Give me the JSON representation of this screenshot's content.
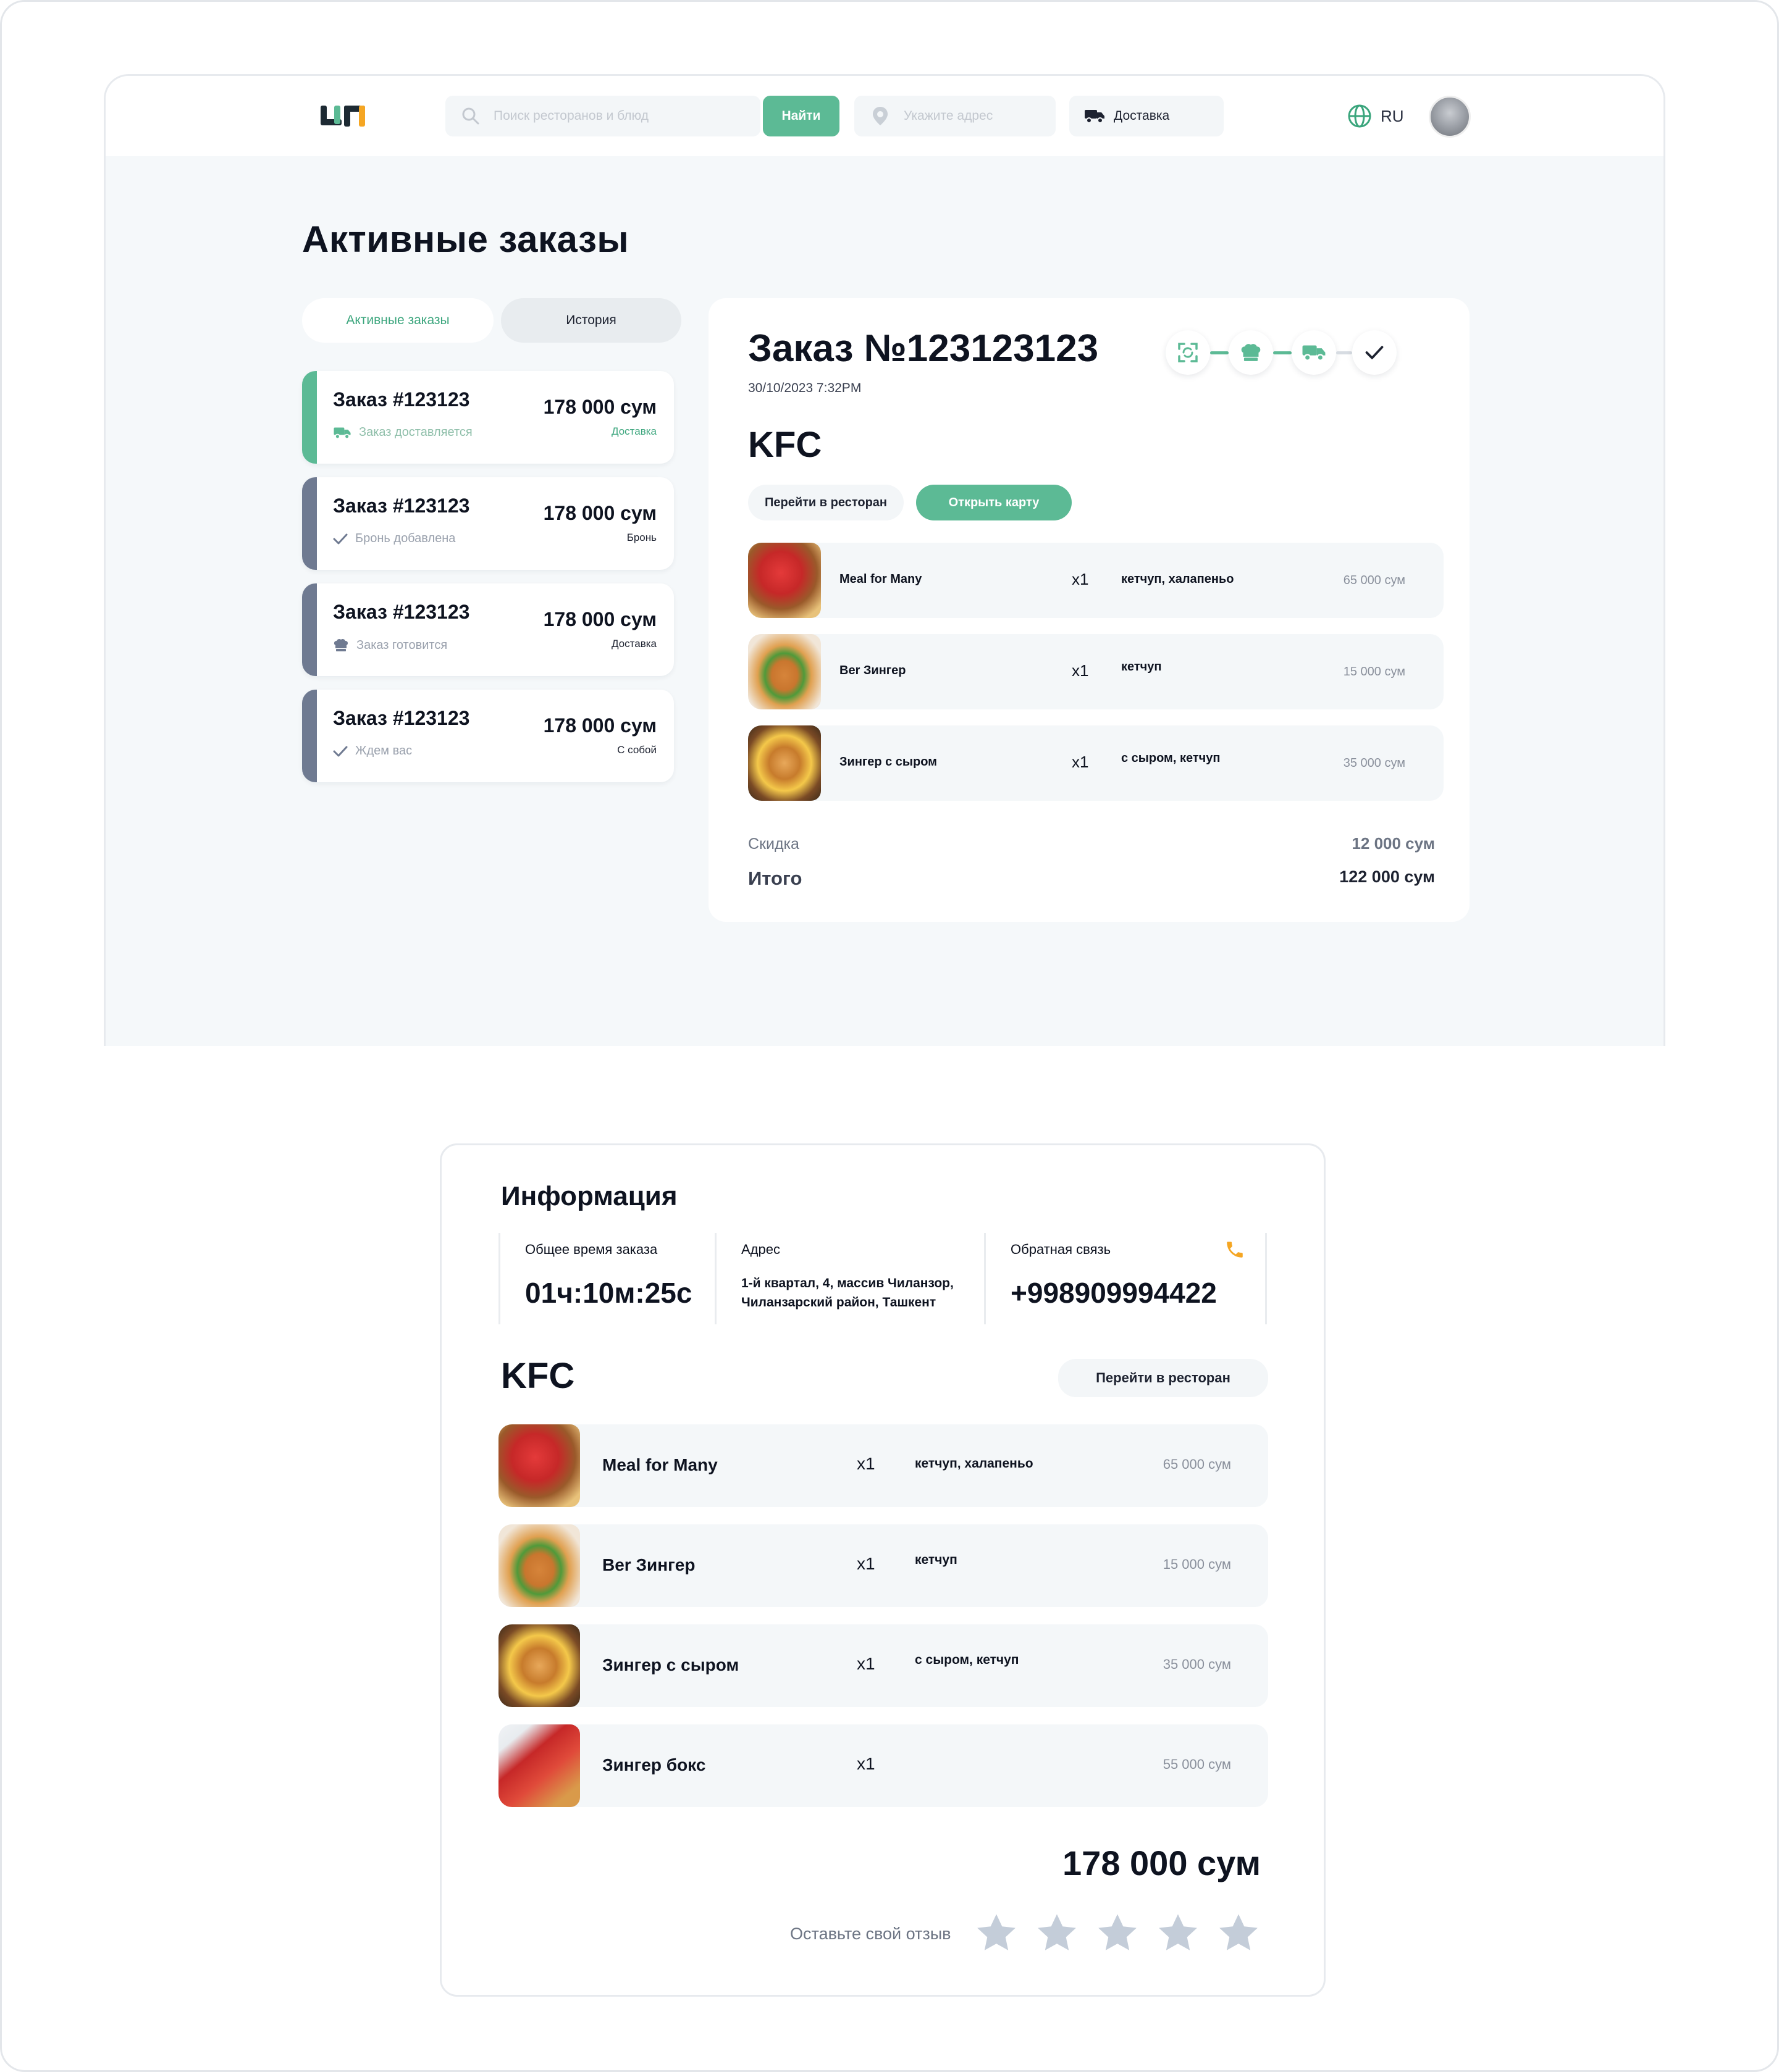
{
  "header": {
    "search_placeholder": "Поиск ресторанов и блюд",
    "find_label": "Найти",
    "address_placeholder": "Укажите адрес",
    "delivery_label": "Доставка",
    "language": "RU"
  },
  "page": {
    "title": "Активные заказы",
    "tabs": {
      "active": "Активные заказы",
      "history": "История"
    }
  },
  "orders": [
    {
      "title": "Заказ #123123",
      "status": "Заказ доставляется",
      "price": "178 000 сум",
      "type": "Доставка",
      "status_icon": "truck-icon",
      "accent": "#5cba95"
    },
    {
      "title": "Заказ #123123",
      "status": "Бронь добавлена",
      "price": "178 000 сум",
      "type": "Бронь",
      "status_icon": "check-icon",
      "accent": "#6f7a91"
    },
    {
      "title": "Заказ #123123",
      "status": "Заказ готовится",
      "price": "178 000 сум",
      "type": "Доставка",
      "status_icon": "chef-hat-icon",
      "accent": "#6f7a91"
    },
    {
      "title": "Заказ #123123",
      "status": "Ждем вас",
      "price": "178 000 сум",
      "type": "С собой",
      "status_icon": "check-icon",
      "accent": "#6f7a91"
    }
  ],
  "detail": {
    "title": "Заказ №123123123",
    "datetime": "30/10/2023  7:32PM",
    "restaurant": "KFC",
    "go_to_restaurant": "Перейти в ресторан",
    "open_map": "Открыть карту",
    "steps": [
      "accepted-icon",
      "chef-hat-icon",
      "truck-icon",
      "check-icon"
    ],
    "items": [
      {
        "name": "Meal for Many",
        "qty": "x1",
        "extras": "кетчуп, халапеньо",
        "price": "65 000 сум"
      },
      {
        "name": "Ber Зингер",
        "qty": "x1",
        "extras": "кетчуп",
        "price": "15 000 сум"
      },
      {
        "name": "Зингер с сыром",
        "qty": "x1",
        "extras": "с сыром, кетчуп",
        "price": "35 000 сум"
      }
    ],
    "discount_label": "Скидка",
    "discount_value": "12 000 сум",
    "total_label": "Итого",
    "total_value": "122 000 сум"
  },
  "info": {
    "title": "Информация",
    "time_label": "Общее время заказа",
    "time_value": "01ч:10м:25с",
    "address_label": "Адрес",
    "address_line1": "1-й квартал, 4, массив Чиланзор,",
    "address_line2": "Чиланзарский район, Ташкент",
    "feedback_label": "Обратная связь",
    "phone": "+998909994422",
    "restaurant": "KFC",
    "go_to_restaurant": "Перейти в ресторан",
    "items": [
      {
        "name": "Meal for Many",
        "qty": "x1",
        "extras": "кетчуп, халапеньо",
        "price": "65 000 сум"
      },
      {
        "name": "Ber Зингер",
        "qty": "x1",
        "extras": "кетчуп",
        "price": "15 000 сум"
      },
      {
        "name": "Зингер с сыром",
        "qty": "x1",
        "extras": "с сыром, кетчуп",
        "price": "35 000 сум"
      },
      {
        "name": "Зингер бокс",
        "qty": "x1",
        "extras": "",
        "price": "55 000 сум"
      }
    ],
    "total": "178 000 сум",
    "review_label": "Оставьте свой отзыв",
    "rating": 0,
    "max_rating": 5
  },
  "colors": {
    "accent": "#5cba95",
    "muted_bar": "#6f7a91",
    "star": "#c4cdd9",
    "phone_icon": "#f5a623"
  }
}
